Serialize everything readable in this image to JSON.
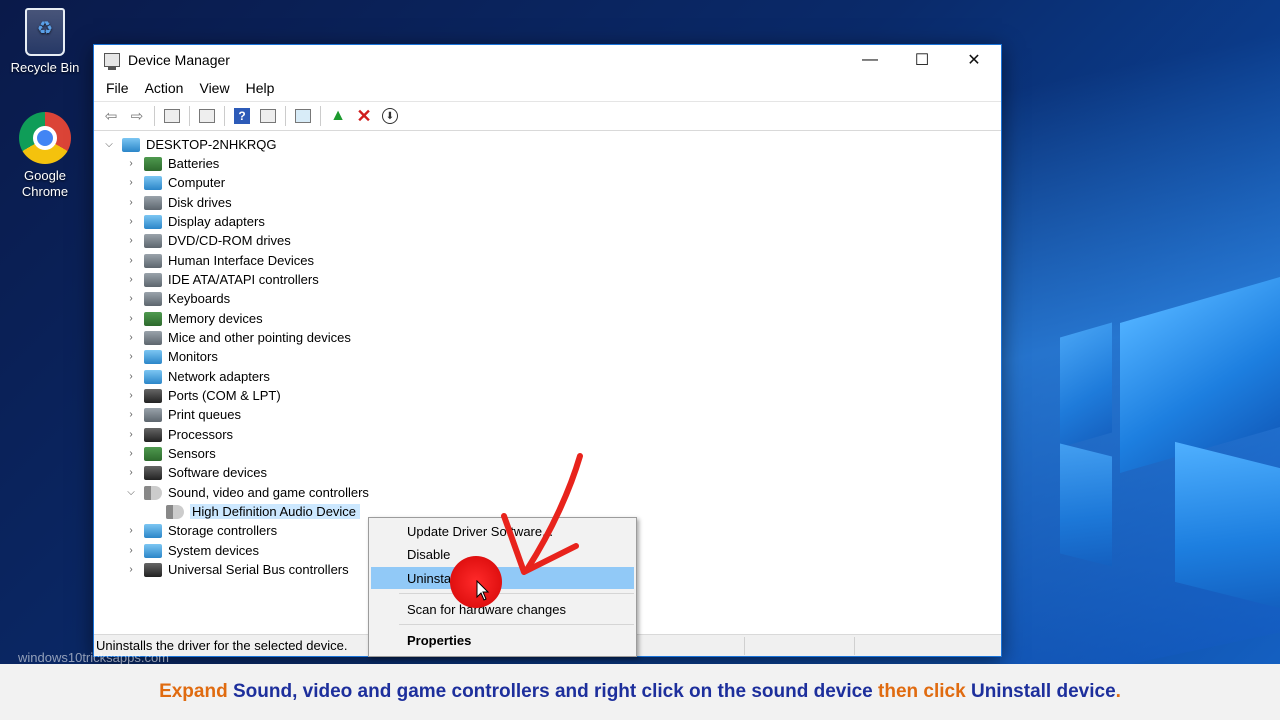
{
  "desktop": {
    "icons": [
      {
        "label": "Recycle Bin"
      },
      {
        "label": "Google Chrome"
      }
    ]
  },
  "window": {
    "title": "Device Manager",
    "controls": {
      "minimize": "—",
      "maximize": "☐",
      "close": "✕"
    },
    "menu": [
      "File",
      "Action",
      "View",
      "Help"
    ],
    "tree": {
      "root": "DESKTOP-2NHKRQG",
      "categories": [
        "Batteries",
        "Computer",
        "Disk drives",
        "Display adapters",
        "DVD/CD-ROM drives",
        "Human Interface Devices",
        "IDE ATA/ATAPI controllers",
        "Keyboards",
        "Memory devices",
        "Mice and other pointing devices",
        "Monitors",
        "Network adapters",
        "Ports (COM & LPT)",
        "Print queues",
        "Processors",
        "Sensors",
        "Software devices",
        "Sound, video and game controllers",
        "Storage controllers",
        "System devices",
        "Universal Serial Bus controllers"
      ],
      "selected_device": "High Definition Audio Device"
    },
    "status_text": "Uninstalls the driver for the selected device."
  },
  "context_menu": {
    "items": [
      "Update Driver Software...",
      "Disable",
      "Uninstall",
      "Scan for hardware changes",
      "Properties"
    ]
  },
  "caption": {
    "w1": "Expand",
    "w2": "Sound, video and game controllers and right click on the sound device",
    "w3": "then click",
    "w4": "Uninstall device",
    "w5": "."
  },
  "watermark": "windows10tricksapps.com",
  "colors": {
    "accent": "#1a73d8",
    "menu_hover": "#91c9f7",
    "caption_orange": "#e06b10",
    "caption_blue": "#1d2f9c"
  }
}
